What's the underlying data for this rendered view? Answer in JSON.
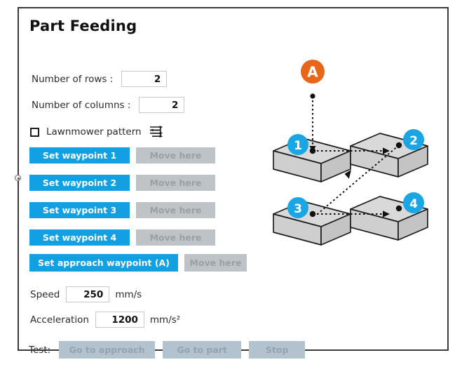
{
  "panel": {
    "title": "Part Feeding"
  },
  "form": {
    "rows": {
      "label": "Number of rows :",
      "value": "2"
    },
    "columns": {
      "label": "Number of columns :",
      "value": "2"
    },
    "lawnmower": {
      "label": "Lawnmower pattern",
      "checked": false,
      "icon": "lawnmower-serpentine-icon"
    }
  },
  "waypoints": [
    {
      "set_label": "Set waypoint 1",
      "move_label": "Move here",
      "move_enabled": false
    },
    {
      "set_label": "Set waypoint 2",
      "move_label": "Move here",
      "move_enabled": false
    },
    {
      "set_label": "Set waypoint 3",
      "move_label": "Move here",
      "move_enabled": false
    },
    {
      "set_label": "Set waypoint 4",
      "move_label": "Move here",
      "move_enabled": false
    }
  ],
  "approach": {
    "set_label": "Set approach waypoint (A)",
    "move_label": "Move here",
    "move_enabled": false
  },
  "motion": {
    "speed": {
      "label": "Speed",
      "value": "250",
      "unit": "mm/s"
    },
    "acceleration": {
      "label": "Acceleration",
      "value": "1200",
      "unit": "mm/s²"
    }
  },
  "test": {
    "label": "Test:",
    "buttons": [
      {
        "label": "Go to approach",
        "enabled": false
      },
      {
        "label": "Go to part",
        "enabled": false
      },
      {
        "label": "Stop",
        "enabled": false
      }
    ]
  },
  "colors": {
    "accent_blue": "#13a0e2",
    "approach_orange": "#e8661a",
    "disabled_gray": "#bdc3c7",
    "test_gray": "#b2c2ce",
    "box_fill": "#d4d4d4",
    "border_dark": "#3a3a3a"
  },
  "diagram": {
    "name": "part-feeding-waypoint-diagram",
    "approach_marker": "A",
    "markers": [
      "1",
      "2",
      "3",
      "4"
    ],
    "path_order": [
      "A",
      "1",
      "2",
      "3",
      "4"
    ],
    "parts": [
      {
        "marker": "1",
        "position": "top-left"
      },
      {
        "marker": "2",
        "position": "top-right"
      },
      {
        "marker": "3",
        "position": "bottom-left"
      },
      {
        "marker": "4",
        "position": "bottom-right"
      }
    ]
  }
}
